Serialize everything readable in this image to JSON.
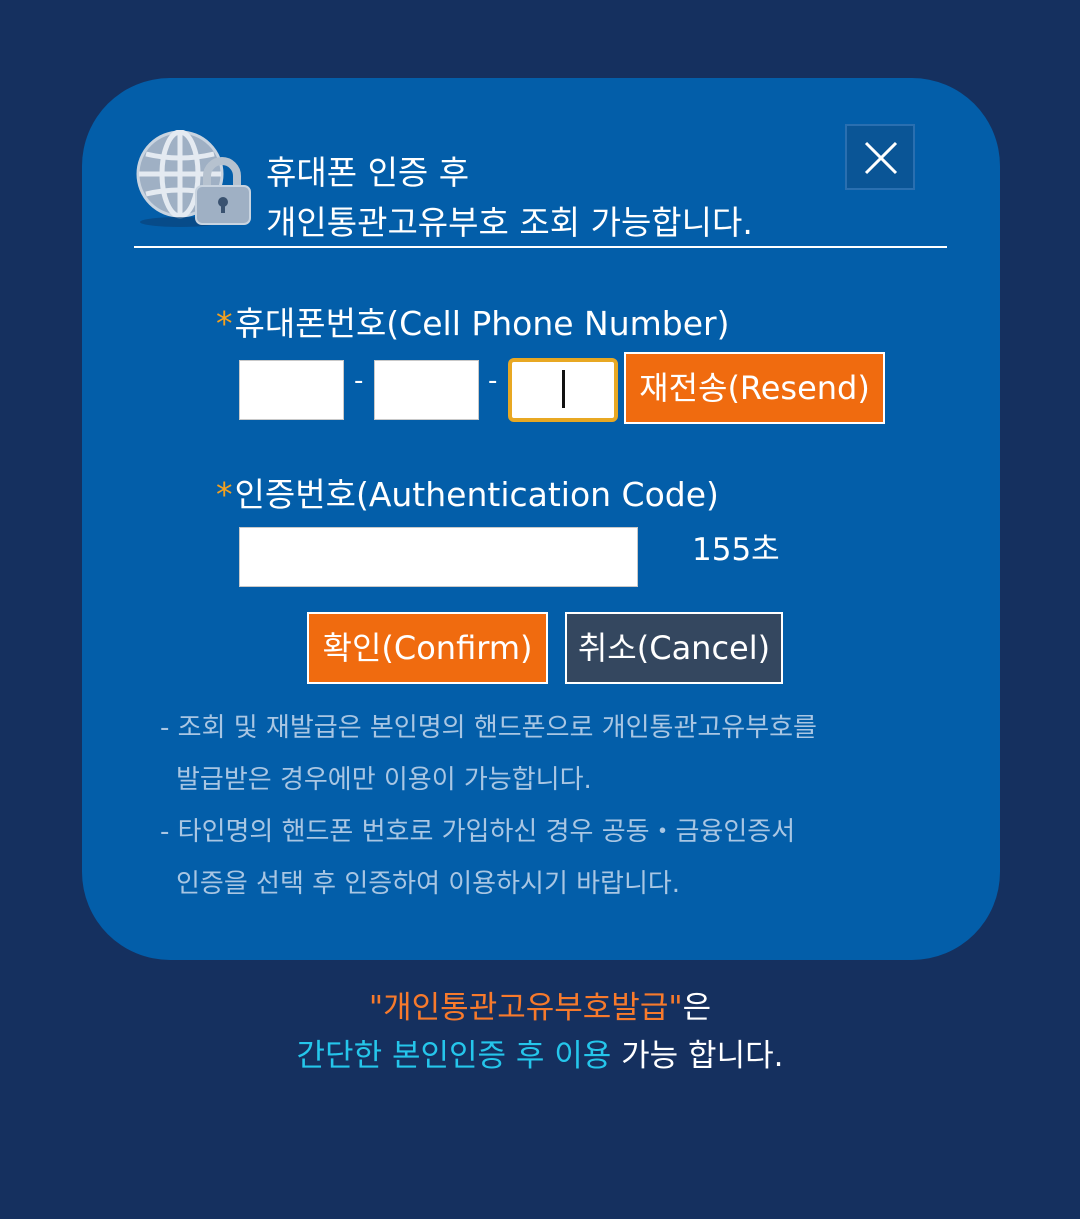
{
  "dialog": {
    "title_line1": "휴대폰 인증 후",
    "title_line2": "개인통관고유부호 조회 가능합니다.",
    "close_icon": "close-x-icon",
    "header_icon": "globe-lock-icon"
  },
  "form": {
    "phone_label": "휴대폰번호(Cell Phone Number)",
    "required_mark": "*",
    "dash": "-",
    "phone_part1": "",
    "phone_part2": "",
    "phone_part3": "",
    "resend_label": "재전송(Resend)",
    "auth_label": "인증번호(Authentication Code)",
    "auth_value": "",
    "timer": "155초",
    "confirm_label": "확인(Confirm)",
    "cancel_label": "취소(Cancel)"
  },
  "notes": [
    "- 조회 및 재발급은 본인명의 핸드폰으로 개인통관고유부호를",
    "발급받은 경우에만 이용이 가능합니다.",
    "- 타인명의 핸드폰 번호로 가입하신 경우 공동・금융인증서",
    "인증을 선택 후 인증하여 이용하시기 바랍니다."
  ],
  "footer": {
    "line1_highlight": "\"개인통관고유부호발급\"",
    "line1_rest": "은",
    "line2_highlight": "간단한 본인인증 후 이용",
    "line2_rest": " 가능 합니다."
  },
  "colors": {
    "background": "#15305f",
    "dialog": "#035ea9",
    "accent_orange": "#f06b0f",
    "star": "#f5a11e",
    "cancel": "#34475f",
    "footer_cyan": "#25c6eb"
  }
}
